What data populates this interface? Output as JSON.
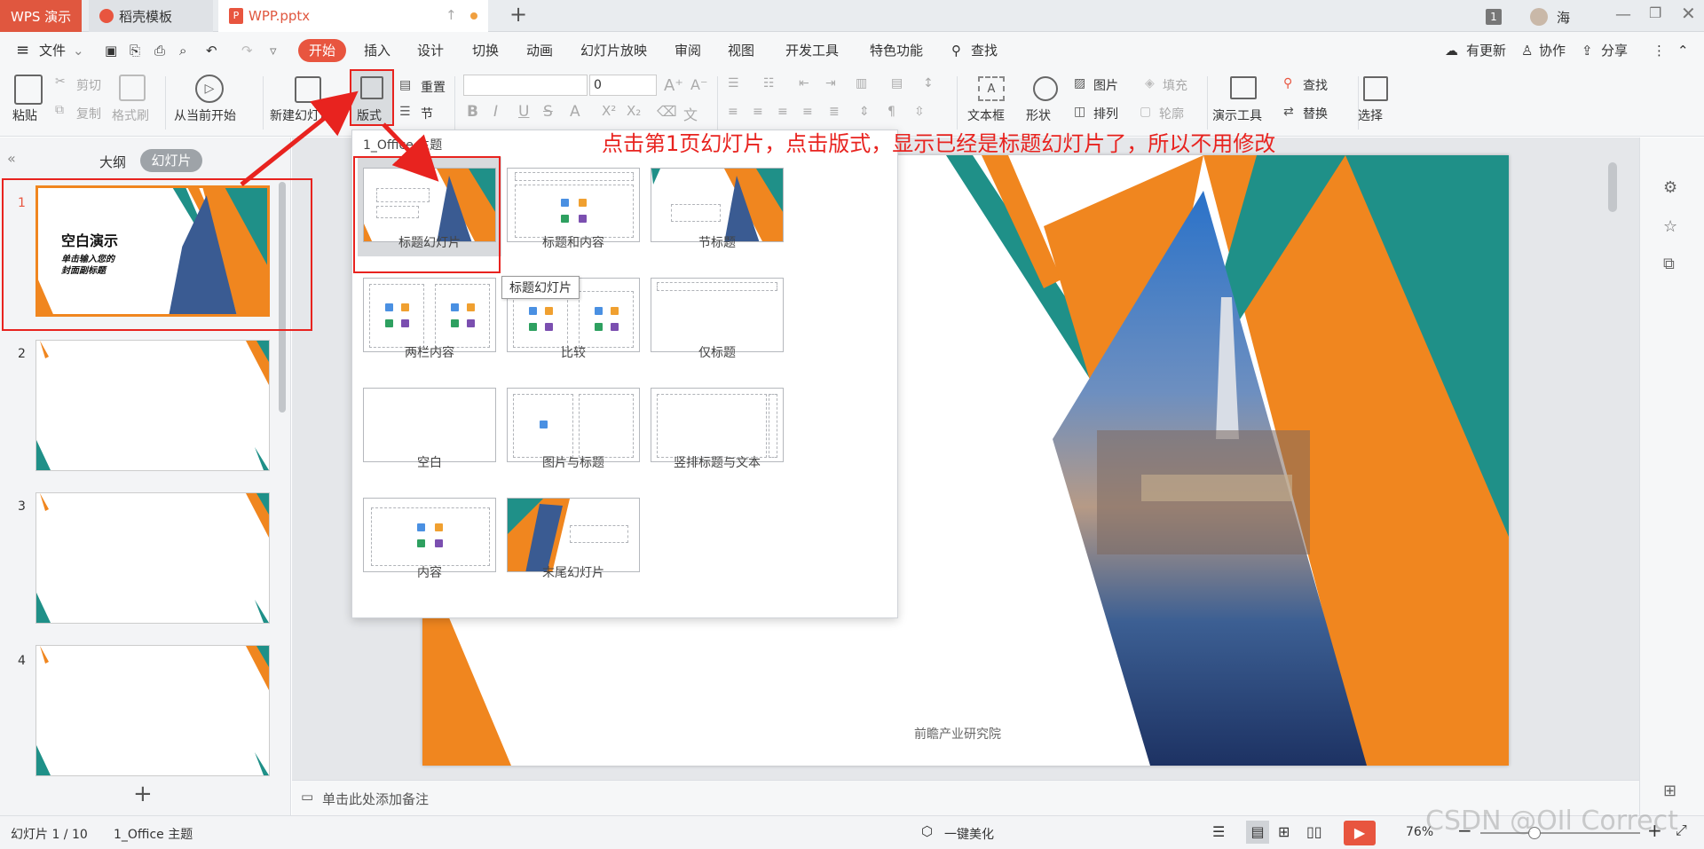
{
  "tabs": {
    "wps": "WPS 演示",
    "daoke": "稻壳模板",
    "file": "WPP.pptx",
    "add": "+",
    "page_badge": "1",
    "user": "海"
  },
  "menu": {
    "file": "文件",
    "items": [
      "开始",
      "插入",
      "设计",
      "切换",
      "动画",
      "幻灯片放映",
      "审阅",
      "视图",
      "开发工具",
      "特色功能"
    ],
    "search": "查找",
    "update": "有更新",
    "collab": "协作",
    "share": "分享"
  },
  "ribbon": {
    "paste": "粘贴",
    "cut": "剪切",
    "copy": "复制",
    "format_painter": "格式刷",
    "from_current": "从当前开始",
    "new_slide": "新建幻灯片",
    "layout": "版式",
    "reset": "重置",
    "section": "节",
    "font_size": "0",
    "textbox": "文本框",
    "shape": "形状",
    "picture": "图片",
    "fill": "填充",
    "arrange": "排列",
    "outline": "轮廓",
    "present_tools": "演示工具",
    "find": "查找",
    "replace": "替换",
    "select": "选择"
  },
  "leftpane": {
    "outline_tab": "大纲",
    "slides_tab": "幻灯片",
    "slide1_title": "空白演示",
    "slide1_subtitle": "单击输入您的封面副标题",
    "slides": [
      "1",
      "2",
      "3",
      "4"
    ]
  },
  "layout_popup": {
    "theme": "1_Office 主题",
    "layouts": [
      "标题幻灯片",
      "标题和内容",
      "节标题",
      "两栏内容",
      "比较",
      "仅标题",
      "空白",
      "图片与标题",
      "竖排标题与文本",
      "内容",
      "末尾幻灯片"
    ],
    "tooltip": "标题幻灯片"
  },
  "annotation": "点击第1页幻灯片，点击版式，显示已经是标题幻灯片了，所以不用修改",
  "slide": {
    "footer": "前瞻产业研究院"
  },
  "notes": {
    "placeholder": "单击此处添加备注"
  },
  "status": {
    "slide_count": "幻灯片 1 / 10",
    "theme": "1_Office 主题",
    "beautify": "一键美化",
    "zoom": "76%"
  },
  "watermark": "CSDN @OIl Correct",
  "colors": {
    "orange": "#f0861f",
    "teal": "#1f9088",
    "accent_red": "#e8231f",
    "wps_red": "#e8553f"
  }
}
